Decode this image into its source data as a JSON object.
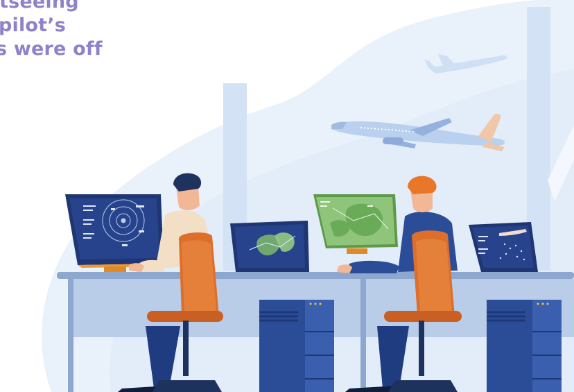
{
  "headline": {
    "line1": "tseeing",
    "line2": "pilot’s",
    "line3": "s were off"
  },
  "colors": {
    "headline": "#8e83c8",
    "sky_blob": "#e8f0fb",
    "desk": "#dfe9f7",
    "chair": "#d96b2a",
    "monitor_frame": "#223a7a",
    "monitor_stand": "#e8952c",
    "tower": "#2c4f9c",
    "radar_screen": "#24418a",
    "map_screen": "#7fb96b"
  },
  "icons": [
    "airplane-icon",
    "radar-icon",
    "map-icon",
    "chair-icon",
    "computer-tower-icon"
  ]
}
